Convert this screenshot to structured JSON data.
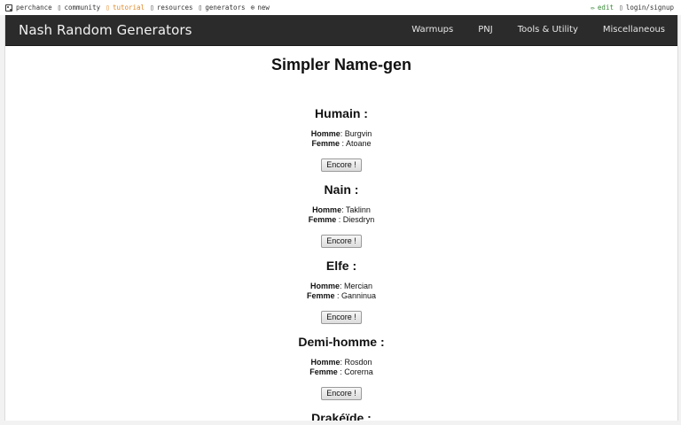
{
  "topbar": {
    "left": [
      {
        "icon": "die-icon",
        "label": "perchance"
      },
      {
        "icon": "community-icon",
        "label": "community"
      },
      {
        "icon": "tutorial-icon",
        "label": "tutorial"
      },
      {
        "icon": "resources-icon",
        "label": "resources"
      },
      {
        "icon": "generators-icon",
        "label": "generators"
      },
      {
        "icon": "plus-circle-icon",
        "label": "new"
      }
    ],
    "right": [
      {
        "icon": "pencil-icon",
        "label": "edit"
      },
      {
        "icon": "user-icon",
        "label": "login/signup"
      }
    ]
  },
  "navbar": {
    "brand": "Nash Random Generators",
    "links": [
      "Warmups",
      "PNJ",
      "Tools & Utility",
      "Miscellaneous"
    ]
  },
  "page": {
    "title": "Simpler Name-gen",
    "male_label": "Homme",
    "female_label": "Femme",
    "button_label": "Encore !",
    "sections": [
      {
        "title": "Humain :",
        "male": "Burgvin",
        "female": "Atoane"
      },
      {
        "title": "Nain :",
        "male": "Taklinn",
        "female": "Diesdryn"
      },
      {
        "title": "Elfe :",
        "male": "Mercian",
        "female": "Ganninua"
      },
      {
        "title": "Demi-homme :",
        "male": "Rosdon",
        "female": "Corerna"
      },
      {
        "title": "Drakéïde :"
      }
    ]
  }
}
